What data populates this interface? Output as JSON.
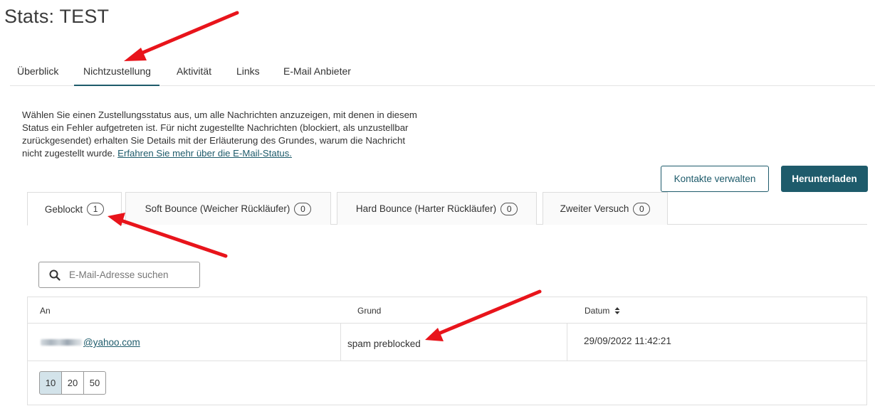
{
  "page": {
    "title": "Stats: TEST"
  },
  "main_tabs": [
    {
      "label": "Überblick",
      "active": false
    },
    {
      "label": "Nichtzustellung",
      "active": true
    },
    {
      "label": "Aktivität",
      "active": false
    },
    {
      "label": "Links",
      "active": false
    },
    {
      "label": "E-Mail Anbieter",
      "active": false
    }
  ],
  "description": {
    "text": "Wählen Sie einen Zustellungsstatus aus, um alle Nachrichten anzuzeigen, mit denen in diesem Status ein Fehler aufgetreten ist. Für nicht zugestellte Nachrichten (blockiert, als unzustellbar zurückgesendet) erhalten Sie Details mit der Erläuterung des Grundes, warum die Nachricht nicht zugestellt wurde.",
    "link": "Erfahren Sie mehr über die E-Mail-Status."
  },
  "actions": {
    "manage_contacts": "Kontakte verwalten",
    "download": "Herunterladen"
  },
  "status_tabs": [
    {
      "label": "Geblockt",
      "count": "1",
      "active": true
    },
    {
      "label": "Soft Bounce (Weicher Rückläufer)",
      "count": "0",
      "active": false
    },
    {
      "label": "Hard Bounce (Harter Rückläufer)",
      "count": "0",
      "active": false
    },
    {
      "label": "Zweiter Versuch",
      "count": "0",
      "active": false
    }
  ],
  "search": {
    "placeholder": "E-Mail-Adresse suchen"
  },
  "table": {
    "columns": [
      "An",
      "Grund",
      "Datum"
    ],
    "sort_icon": "sort-updown-icon",
    "rows": [
      {
        "email_domain": "@yahoo.com",
        "reason": "spam preblocked",
        "date": "29/09/2022 11:42:21"
      }
    ]
  },
  "pagination": {
    "options": [
      "10",
      "20",
      "50"
    ],
    "selected": "10"
  },
  "colors": {
    "accent": "#1e5b6b",
    "annotation_arrow": "#e8141b",
    "pager_active": "#d3e3ea"
  }
}
